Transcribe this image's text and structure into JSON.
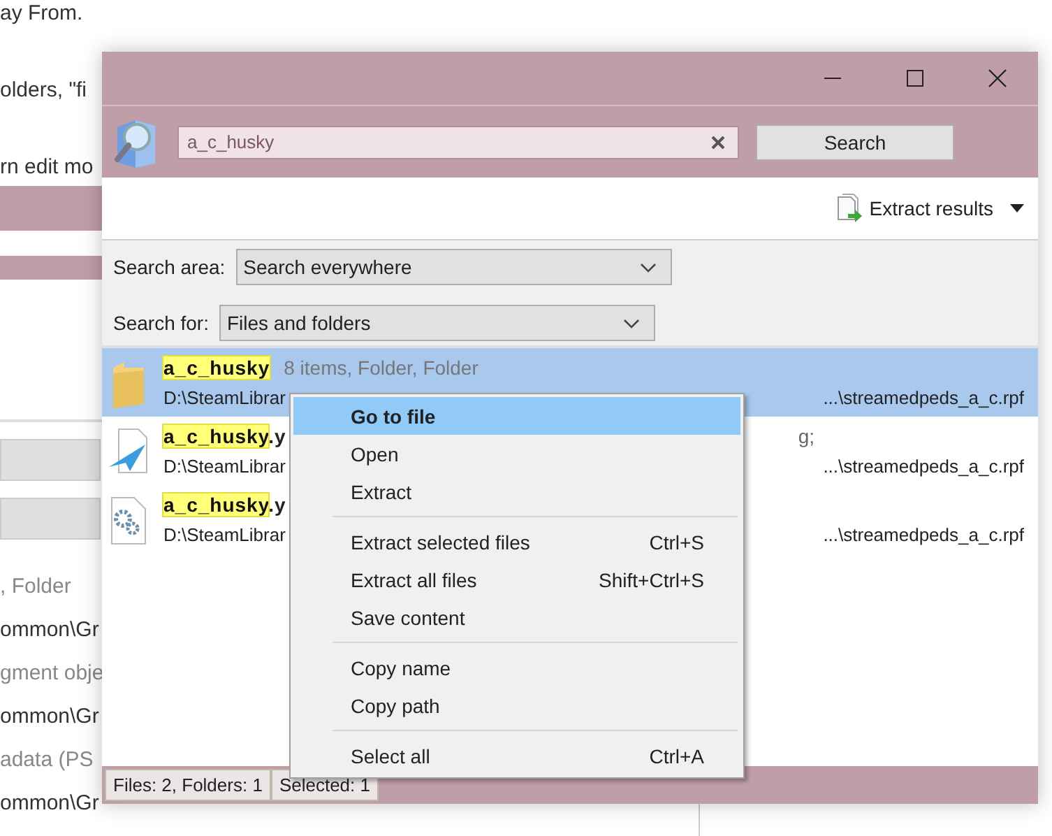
{
  "background": {
    "texts": [
      "ay From.",
      "olders, \"fi",
      "rn edit mo"
    ],
    "list_texts": [
      {
        "text": ", Folder",
        "kind": "meta"
      },
      {
        "text": "ommon\\Gr",
        "kind": "path"
      },
      {
        "text": "gment obje",
        "kind": "meta"
      },
      {
        "text": "ommon\\Gr",
        "kind": "path"
      },
      {
        "text": "adata (PS",
        "kind": "meta"
      },
      {
        "text": "ommon\\Gr",
        "kind": "path"
      }
    ]
  },
  "search": {
    "value": "a_c_husky",
    "button": "Search"
  },
  "toolbar": {
    "extract": "Extract results"
  },
  "options": [
    {
      "label": "Search area:",
      "value": "Search everywhere"
    },
    {
      "label": "Search for:",
      "value": "Files and folders"
    }
  ],
  "results": [
    {
      "kind": "folder",
      "match": "a_c_husky",
      "details": "8 items, Folder, Folder",
      "path": "D:\\SteamLibrar",
      "path_end": "...\\streamedpeds_a_c.rpf",
      "selected": true
    },
    {
      "kind": "plane",
      "match": "a_c_husky",
      "rest": ".y",
      "path": "D:\\SteamLibrar",
      "path_end": "...\\streamedpeds_a_c.rpf",
      "note": "g;",
      "selected": false
    },
    {
      "kind": "gear",
      "match": "a_c_husky",
      "rest": ".y",
      "path": "D:\\SteamLibrar",
      "path_end": "...\\streamedpeds_a_c.rpf",
      "selected": false
    }
  ],
  "status_bar": [
    "Files: 2, Folders: 1",
    "Selected: 1"
  ],
  "menu": [
    {
      "kind": "item",
      "label": "Go to file",
      "selected": true,
      "default": true
    },
    {
      "kind": "item",
      "label": "Open",
      "selected": false,
      "default": false
    },
    {
      "kind": "item",
      "label": "Extract",
      "selected": false,
      "default": false
    },
    {
      "kind": "separator"
    },
    {
      "kind": "item",
      "label": "Extract selected files",
      "shortcut": "Ctrl+S",
      "selected": false,
      "default": false
    },
    {
      "kind": "item",
      "label": "Extract all files",
      "shortcut": "Shift+Ctrl+S",
      "selected": false,
      "default": false
    },
    {
      "kind": "item",
      "label": "Save content",
      "selected": false,
      "default": false
    },
    {
      "kind": "separator"
    },
    {
      "kind": "item",
      "label": "Copy name",
      "selected": false,
      "default": false
    },
    {
      "kind": "item",
      "label": "Copy path",
      "selected": false,
      "default": false
    },
    {
      "kind": "separator"
    },
    {
      "kind": "item",
      "label": "Select all",
      "shortcut": "Ctrl+A",
      "selected": false,
      "default": false
    }
  ]
}
